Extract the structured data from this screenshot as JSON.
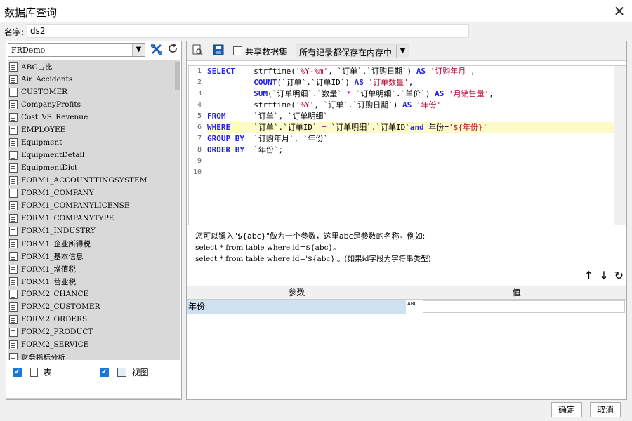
{
  "window": {
    "title": "数据库查询",
    "close_glyph": "✕"
  },
  "name_field": {
    "label": "名字:",
    "value": "ds2"
  },
  "datasource": {
    "selected": "FRDemo"
  },
  "tables": [
    "ABC占比",
    "Air_Accidents",
    "CUSTOMER",
    "CompanyProfits",
    "Cost_VS_Revenue",
    "EMPLOYEE",
    "Equipment",
    "EquipmentDetail",
    "EquipmentDict",
    "FORM1_ACCOUNTTINGSYSTEM",
    "FORM1_COMPANY",
    "FORM1_COMPANYLICENSE",
    "FORM1_COMPANYTYPE",
    "FORM1_INDUSTRY",
    "FORM1_企业所得税",
    "FORM1_基本信息",
    "FORM1_增值税",
    "FORM1_营业税",
    "FORM2_CHANCE",
    "FORM2_CUSTOMER",
    "FORM2_ORDERS",
    "FORM2_PRODUCT",
    "FORM2_SERVICE",
    "财务指标分析"
  ],
  "filters": {
    "table_label": "表",
    "view_label": "视图"
  },
  "toolbar": {
    "share_label": "共享数据集",
    "memory_option": "所有记录都保存在内存中"
  },
  "sql_lines": [
    "SELECT    strftime('%Y-%m', `订单`.`订购日期`) AS '订购年月',",
    "          COUNT(`订单`.`订单ID`) AS '订单数量',",
    "          SUM(`订单明细`.`数量` * `订单明细`.`单价`) AS '月销售量',",
    "          strftime('%Y', `订单`.`订购日期`) AS '年份'",
    "FROM      `订单`, `订单明细`",
    "WHERE     `订单`.`订单ID` = `订单明细`.`订单ID`and 年份='${年份}'",
    "GROUP BY  `订购年月`, `年份`",
    "ORDER BY  `年份`;",
    "",
    ""
  ],
  "line_numbers": [
    "1",
    "2",
    "3",
    "4",
    "5",
    "6",
    "7",
    "8",
    "9",
    "10"
  ],
  "hint": {
    "line1": "您可以键入\"${abc}\"做为一个参数，这里abc是参数的名称。例如:",
    "line2": "select * from table where id=${abc}。",
    "line3": "select * from table where id='${abc}'。(如果id字段为字符串类型)"
  },
  "params": {
    "col_name": "参数",
    "col_value": "值",
    "rows": [
      {
        "name": "年份",
        "type": "ABC",
        "value": ""
      }
    ]
  },
  "buttons": {
    "ok": "确定",
    "cancel": "取消"
  }
}
